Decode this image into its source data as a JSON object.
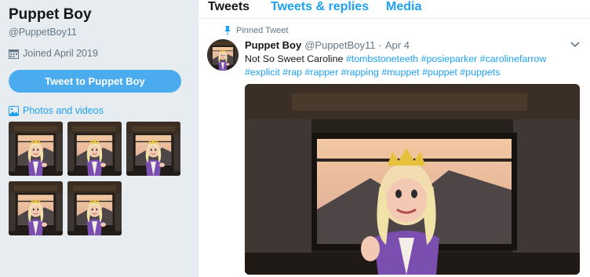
{
  "profile": {
    "name": "Puppet Boy",
    "handle": "@PuppetBoy11",
    "joined": "Joined April 2019",
    "tweet_to_button": "Tweet to Puppet Boy",
    "photos_link": "Photos and videos"
  },
  "tabs": [
    {
      "label": "Tweets",
      "active": true
    },
    {
      "label": "Tweets & replies",
      "active": false
    },
    {
      "label": "Media",
      "active": false
    }
  ],
  "tweet": {
    "pinned_label": "Pinned Tweet",
    "author": "Puppet Boy",
    "handle": "@PuppetBoy11",
    "separator": "·",
    "date": "Apr 4",
    "text_plain": "Not So Sweet Caroline",
    "hashtags": [
      "#tombstoneteeth",
      "#posieparker",
      "#carolinefarrow",
      "#explicit",
      "#rap",
      "#rapper",
      "#rapping",
      "#muppet",
      "#puppet",
      "#puppets"
    ]
  },
  "colors": {
    "accent": "#1da1f2",
    "button": "#4aabee",
    "background": "#e6ecf0",
    "muted": "#657786"
  },
  "icons": [
    "calendar-icon",
    "photo-icon",
    "pin-icon",
    "chevron-down-icon"
  ]
}
